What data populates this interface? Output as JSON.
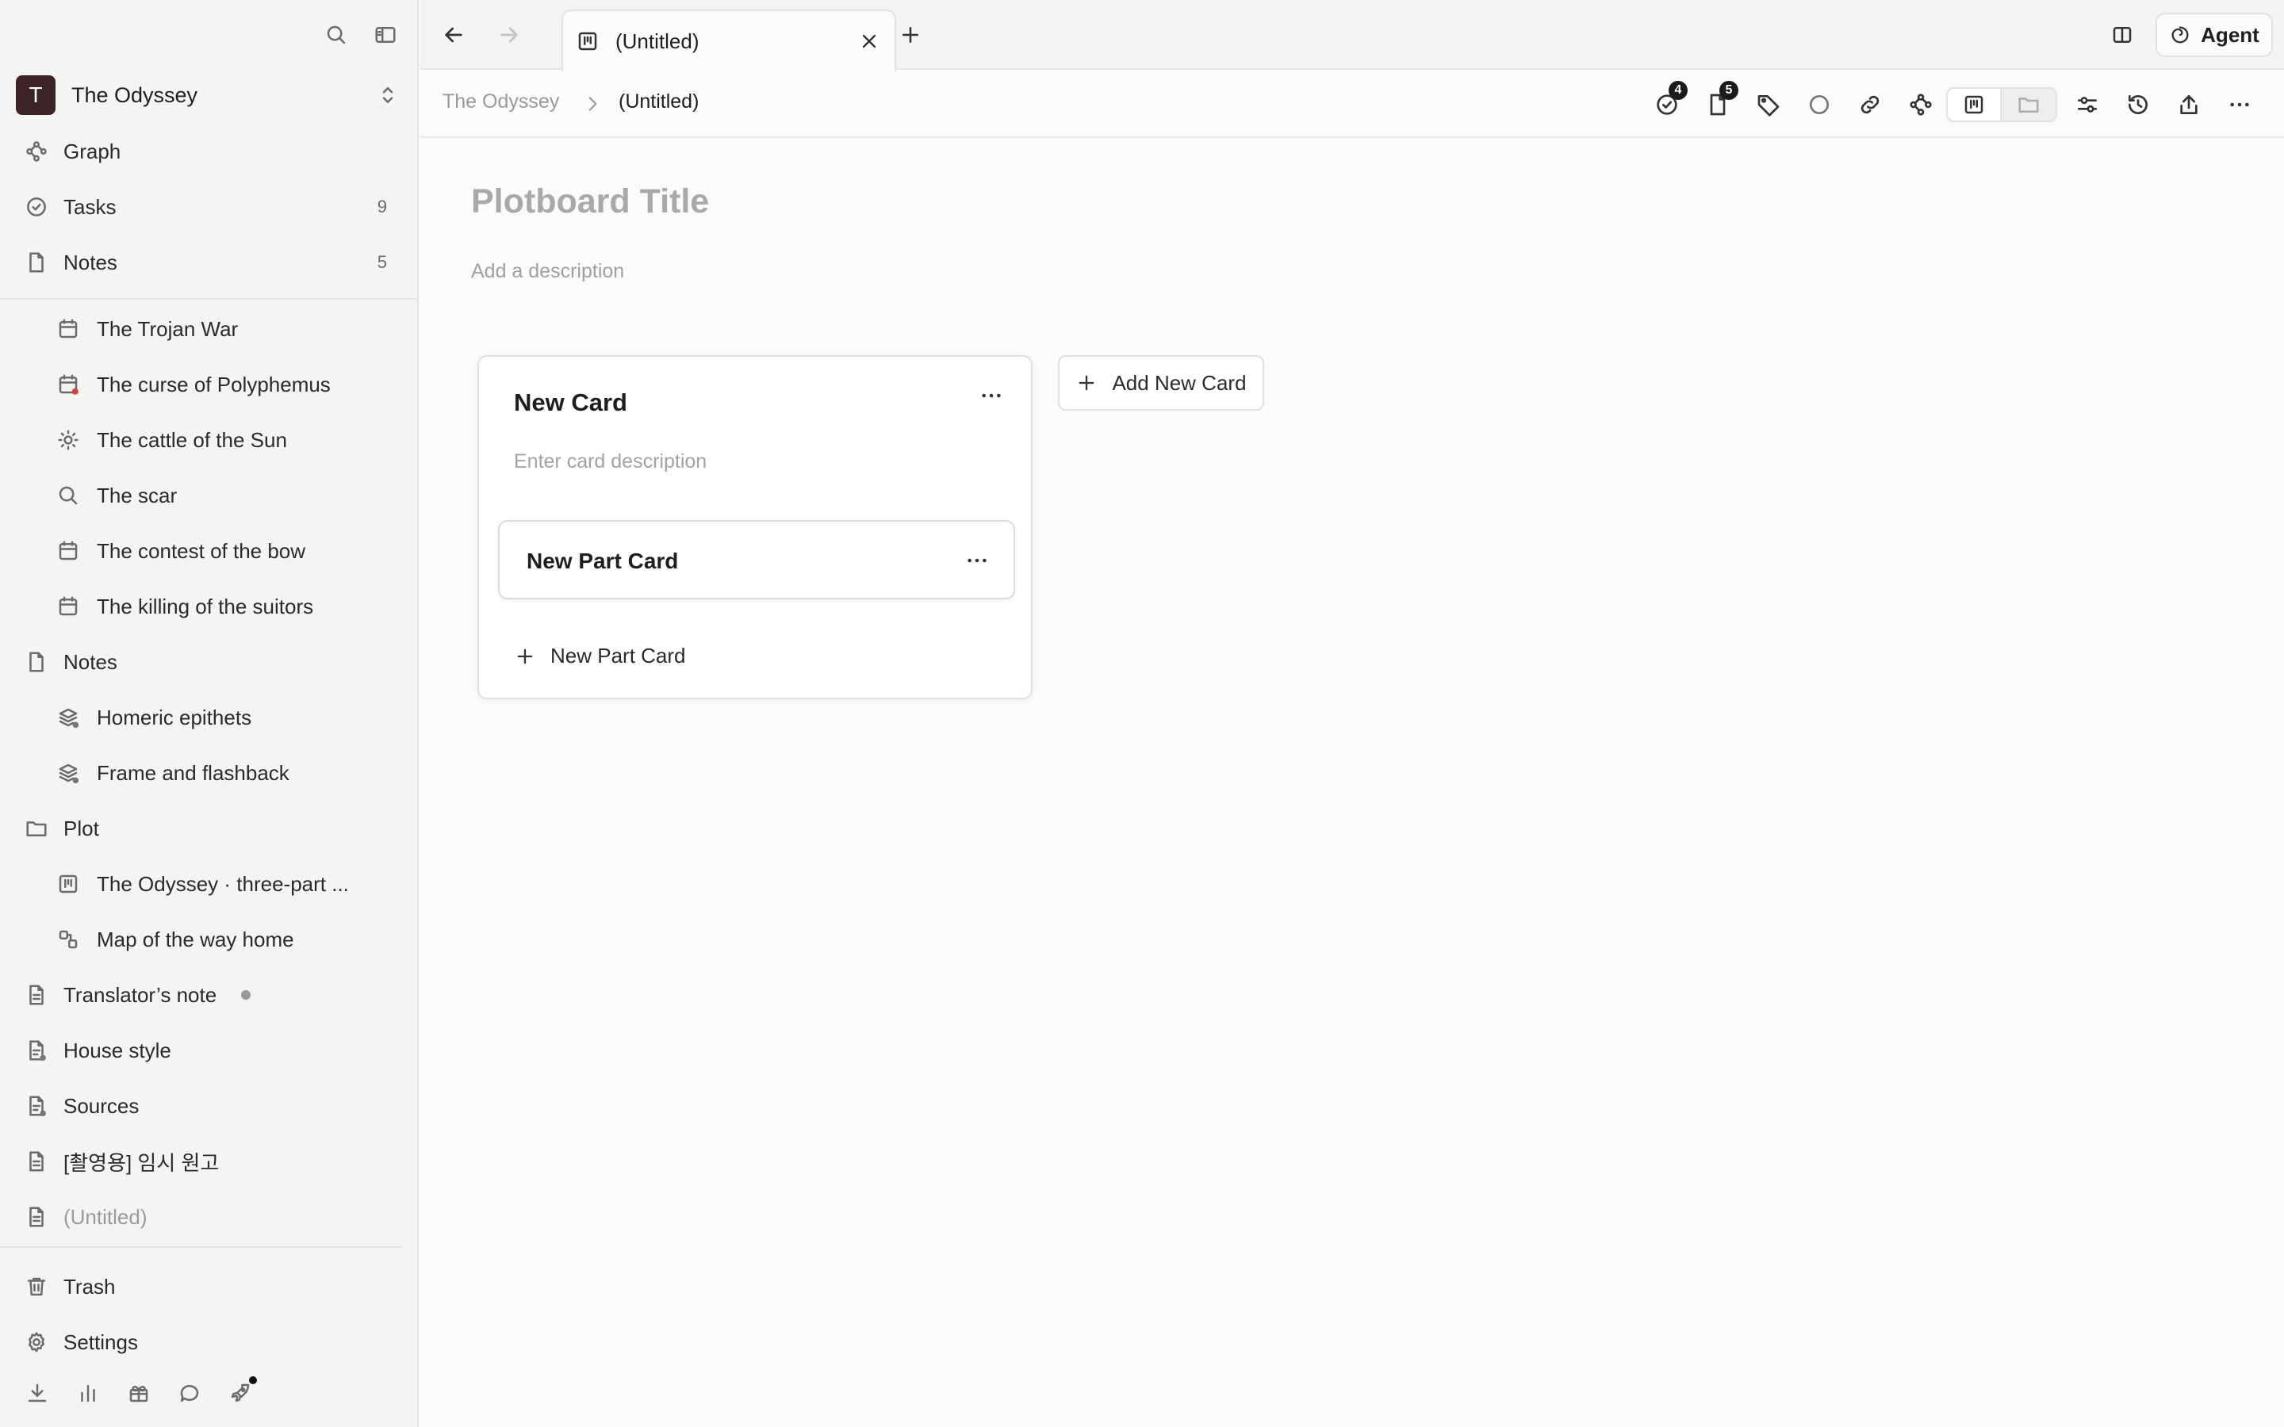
{
  "workspace": {
    "initial": "T",
    "name": "The Odyssey"
  },
  "sidebar": {
    "nav": [
      {
        "label": "Graph",
        "icon": "graph-icon"
      },
      {
        "label": "Tasks",
        "icon": "check-circle-icon",
        "count": "9"
      },
      {
        "label": "Notes",
        "icon": "page-icon",
        "count": "5"
      }
    ],
    "notes_children": [
      {
        "label": "The Trojan War",
        "icon": "calendar-icon"
      },
      {
        "label": "The curse of Polyphemus",
        "icon": "calendar-icon"
      },
      {
        "label": "The cattle of the Sun",
        "icon": "sun-icon"
      },
      {
        "label": "The scar",
        "icon": "search-icon"
      },
      {
        "label": "The contest of the bow",
        "icon": "calendar-icon"
      },
      {
        "label": "The killing of the suitors",
        "icon": "calendar-icon"
      }
    ],
    "notes_folder": {
      "label": "Notes",
      "icon": "page-icon"
    },
    "notes_folder_children": [
      {
        "label": "Homeric epithets",
        "icon": "layers-icon"
      },
      {
        "label": "Frame and flashback",
        "icon": "layers-icon"
      }
    ],
    "plot_folder": {
      "label": "Plot",
      "icon": "folder-icon"
    },
    "plot_children": [
      {
        "label": "The Odyssey · three-part ...",
        "icon": "board-icon"
      },
      {
        "label": "Map of the way home",
        "icon": "map-icon"
      }
    ],
    "docs": [
      {
        "label": "Translator’s note",
        "icon": "document-icon"
      },
      {
        "label": "House style",
        "icon": "document-icon"
      },
      {
        "label": "Sources",
        "icon": "document-icon"
      },
      {
        "label": "[촬영용] 임시 원고",
        "icon": "document-icon"
      },
      {
        "label": "(Untitled)",
        "icon": "document-icon"
      }
    ],
    "footer": [
      {
        "label": "Trash",
        "icon": "trash-icon"
      },
      {
        "label": "Settings",
        "icon": "gear-icon"
      }
    ],
    "bottom_icons": [
      "download-icon",
      "stats-icon",
      "gift-icon",
      "chat-icon",
      "rocket-icon"
    ]
  },
  "tabs": [
    {
      "label": "(Untitled)",
      "icon": "board-icon"
    }
  ],
  "agent_label": "Agent",
  "breadcrumb": {
    "root": "The Odyssey",
    "current": "(Untitled)"
  },
  "toolbar": {
    "tasks_badge": "4",
    "notes_badge": "5"
  },
  "board": {
    "title_placeholder": "Plotboard Title",
    "description_placeholder": "Add a description",
    "cards": [
      {
        "title": "New Card",
        "description_placeholder": "Enter card description",
        "parts": [
          {
            "title": "New Part Card"
          }
        ],
        "add_part_label": "New Part Card"
      }
    ],
    "add_card_label": "Add New Card"
  },
  "colors": {
    "workspace_avatar": "#3b2226",
    "badge": "#1b1b1b",
    "alert_dot": "#d0423b"
  }
}
